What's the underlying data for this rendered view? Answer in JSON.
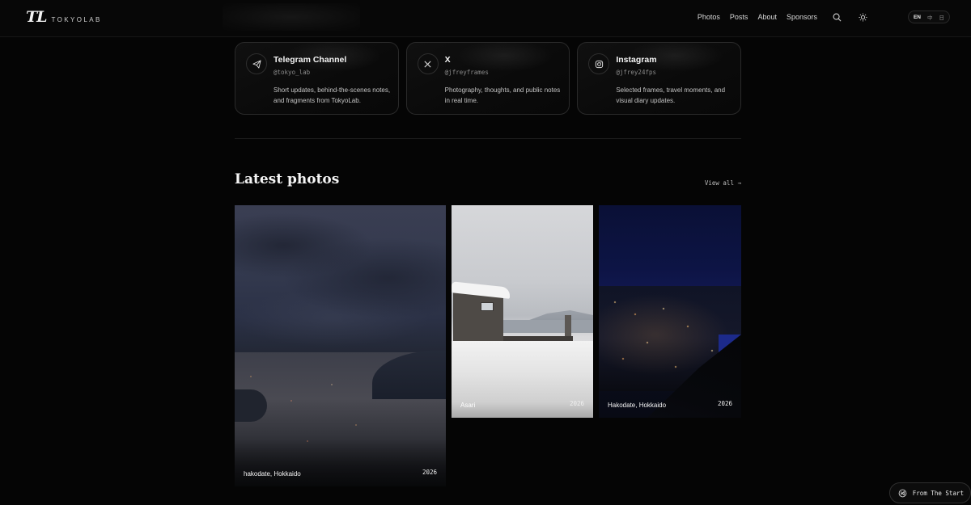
{
  "header": {
    "logo_mark": "TL",
    "logo_text": "TOKYOLAB",
    "nav": [
      "Photos",
      "Posts",
      "About",
      "Sponsors"
    ],
    "languages": [
      {
        "code": "EN",
        "active": true
      },
      {
        "code": "中",
        "active": false
      },
      {
        "code": "日",
        "active": false
      }
    ]
  },
  "social_cards": [
    {
      "title": "Telegram Channel",
      "handle": "@tokyo_lab",
      "description": "Short updates, behind-the-scenes notes, and fragments from TokyoLab.",
      "icon": "telegram-icon"
    },
    {
      "title": "X",
      "handle": "@jfreyframes",
      "description": "Photography, thoughts, and public notes in real time.",
      "icon": "x-icon"
    },
    {
      "title": "Instagram",
      "handle": "@jfrey24fps",
      "description": "Selected frames, travel moments, and visual diary updates.",
      "icon": "instagram-icon"
    }
  ],
  "latest": {
    "title": "Latest photos",
    "view_all": "View all →"
  },
  "photos": [
    {
      "place": "hakodate, Hokkaido",
      "year": "2026"
    },
    {
      "place": "Asari",
      "year": "2026"
    },
    {
      "place": "Hakodate, Hokkaido",
      "year": "2026"
    }
  ],
  "fab": {
    "label": "From The Start"
  }
}
